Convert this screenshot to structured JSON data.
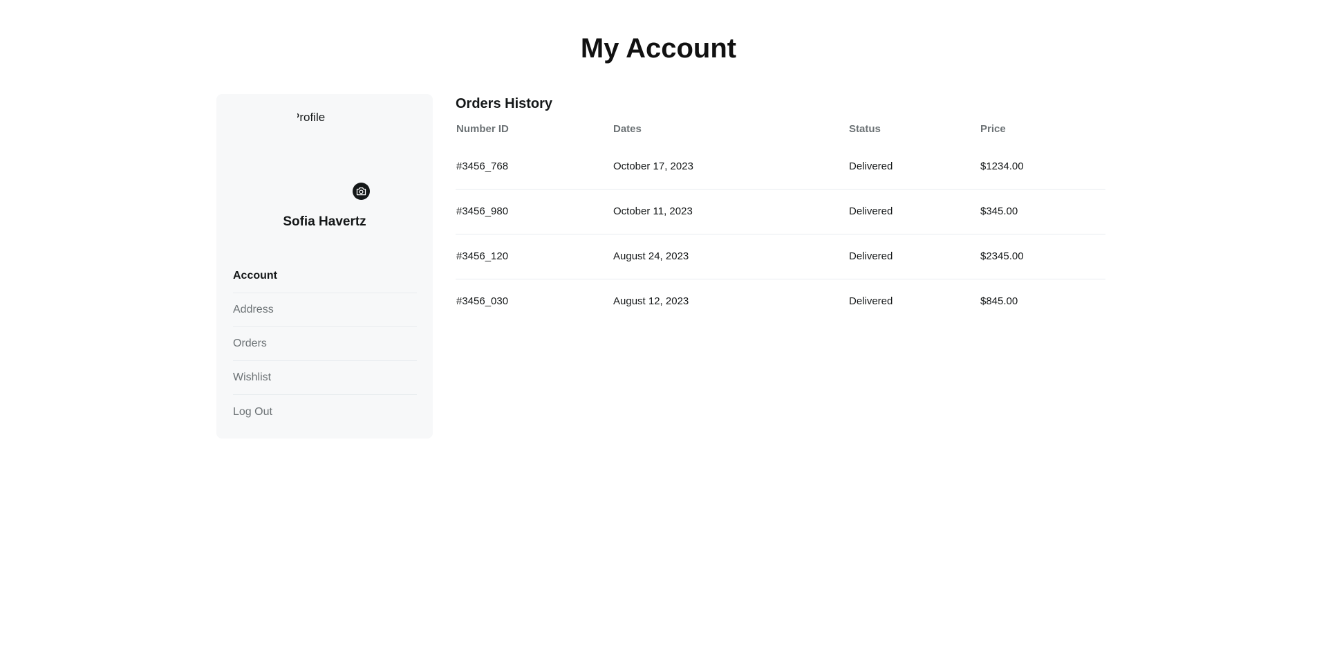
{
  "page": {
    "title": "My Account"
  },
  "sidebar": {
    "avatar_alt": "Profile",
    "user_name": "Sofia Havertz",
    "camera_icon": "camera-icon",
    "items": [
      {
        "label": "Account",
        "active": true
      },
      {
        "label": "Address",
        "active": false
      },
      {
        "label": "Orders",
        "active": false
      },
      {
        "label": "Wishlist",
        "active": false
      },
      {
        "label": "Log Out",
        "active": false
      }
    ]
  },
  "orders": {
    "title": "Orders History",
    "columns": [
      "Number ID",
      "Dates",
      "Status",
      "Price"
    ],
    "rows": [
      {
        "id": "#3456_768",
        "date": "October 17, 2023",
        "status": "Delivered",
        "price": "$1234.00"
      },
      {
        "id": "#3456_980",
        "date": "October 11, 2023",
        "status": "Delivered",
        "price": "$345.00"
      },
      {
        "id": "#3456_120",
        "date": "August 24, 2023",
        "status": "Delivered",
        "price": "$2345.00"
      },
      {
        "id": "#3456_030",
        "date": "August 12, 2023",
        "status": "Delivered",
        "price": "$845.00"
      }
    ]
  },
  "colors": {
    "text_primary": "#141718",
    "text_muted": "#6c7275",
    "sidebar_bg": "#f7f8f9",
    "divider": "#e8ecef"
  }
}
